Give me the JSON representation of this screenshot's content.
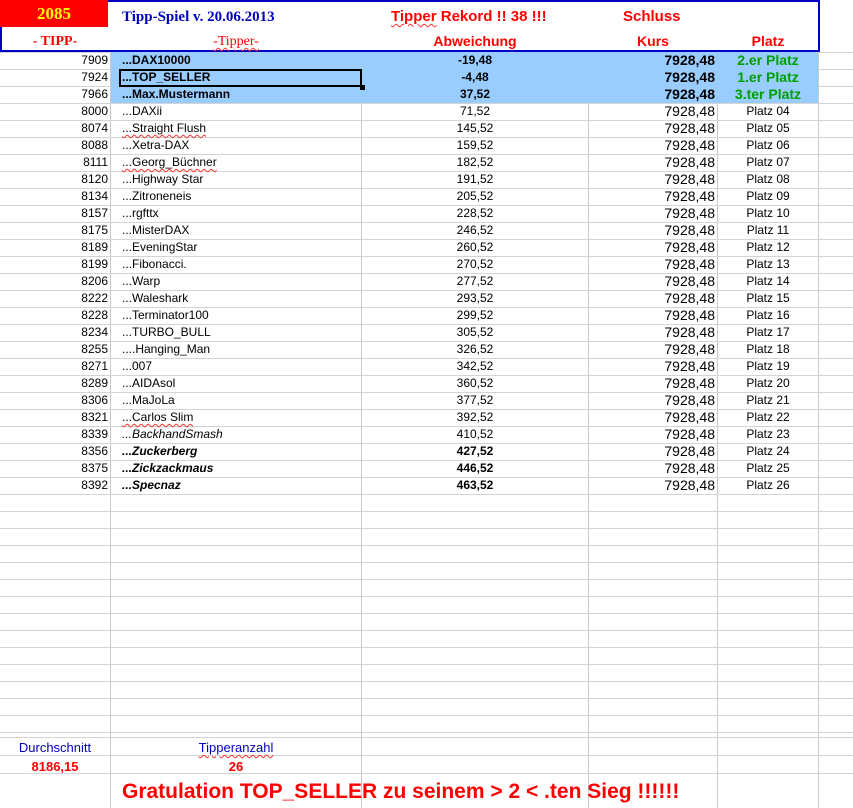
{
  "header": {
    "number": "2085",
    "title": "Tipp-Spiel v. 20.06.2013",
    "record_word": "Tipper",
    "record_rest": " Rekord !!  38  !!!",
    "schluss": "Schluss",
    "col_tipp": "- TIPP-",
    "col_tipper": "-Tipper-",
    "col_abweichung": "Abweichung",
    "col_kurs": "Kurs",
    "col_platz": "Platz"
  },
  "rows": [
    {
      "tipp": "7909",
      "name": "...DAX10000",
      "abw": "-19,48",
      "kurs": "7928,48",
      "platz": "2.er Platz"
    },
    {
      "tipp": "7924",
      "name": "...TOP_SELLER",
      "abw": "-4,48",
      "kurs": "7928,48",
      "platz": "1.er Platz"
    },
    {
      "tipp": "7966",
      "name": "...Max.Mustermann",
      "abw": "37,52",
      "kurs": "7928,48",
      "platz": "3.ter Platz"
    },
    {
      "tipp": "8000",
      "name": "...DAXii",
      "abw": "71,52",
      "kurs": "7928,48",
      "platz": "Platz 04"
    },
    {
      "tipp": "8074",
      "name": "...Straight Flush",
      "abw": "145,52",
      "kurs": "7928,48",
      "platz": "Platz 05"
    },
    {
      "tipp": "8088",
      "name": "...Xetra-DAX",
      "abw": "159,52",
      "kurs": "7928,48",
      "platz": "Platz 06"
    },
    {
      "tipp": "8111",
      "name": "...Georg_Büchner",
      "abw": "182,52",
      "kurs": "7928,48",
      "platz": "Platz 07"
    },
    {
      "tipp": "8120",
      "name": "...Highway Star",
      "abw": "191,52",
      "kurs": "7928,48",
      "platz": "Platz 08"
    },
    {
      "tipp": "8134",
      "name": "...Zitroneneis",
      "abw": "205,52",
      "kurs": "7928,48",
      "platz": "Platz 09"
    },
    {
      "tipp": "8157",
      "name": "...rgfttx",
      "abw": "228,52",
      "kurs": "7928,48",
      "platz": "Platz 10"
    },
    {
      "tipp": "8175",
      "name": "...MisterDAX",
      "abw": "246,52",
      "kurs": "7928,48",
      "platz": "Platz 11"
    },
    {
      "tipp": "8189",
      "name": "...EveningStar",
      "abw": "260,52",
      "kurs": "7928,48",
      "platz": "Platz 12"
    },
    {
      "tipp": "8199",
      "name": "...Fibonacci.",
      "abw": "270,52",
      "kurs": "7928,48",
      "platz": "Platz 13"
    },
    {
      "tipp": "8206",
      "name": "...Warp",
      "abw": "277,52",
      "kurs": "7928,48",
      "platz": "Platz 14"
    },
    {
      "tipp": "8222",
      "name": "...Waleshark",
      "abw": "293,52",
      "kurs": "7928,48",
      "platz": "Platz 15"
    },
    {
      "tipp": "8228",
      "name": "...Terminator100",
      "abw": "299,52",
      "kurs": "7928,48",
      "platz": "Platz 16"
    },
    {
      "tipp": "8234",
      "name": "...TURBO_BULL",
      "abw": "305,52",
      "kurs": "7928,48",
      "platz": "Platz 17"
    },
    {
      "tipp": "8255",
      "name": "....Hanging_Man",
      "abw": "326,52",
      "kurs": "7928,48",
      "platz": "Platz 18"
    },
    {
      "tipp": "8271",
      "name": "...007",
      "abw": "342,52",
      "kurs": "7928,48",
      "platz": "Platz 19"
    },
    {
      "tipp": "8289",
      "name": "...AIDAsol",
      "abw": "360,52",
      "kurs": "7928,48",
      "platz": "Platz 20"
    },
    {
      "tipp": "8306",
      "name": "...MaJoLa",
      "abw": "377,52",
      "kurs": "7928,48",
      "platz": "Platz 21"
    },
    {
      "tipp": "8321",
      "name": "...Carlos Slim",
      "abw": "392,52",
      "kurs": "7928,48",
      "platz": "Platz 22"
    },
    {
      "tipp": "8339",
      "name": "...BackhandSmash",
      "abw": "410,52",
      "kurs": "7928,48",
      "platz": "Platz 23"
    },
    {
      "tipp": "8356",
      "name": "...Zuckerberg",
      "abw": "427,52",
      "kurs": "7928,48",
      "platz": "Platz 24"
    },
    {
      "tipp": "8375",
      "name": "...Zickzackmaus",
      "abw": "446,52",
      "kurs": "7928,48",
      "platz": "Platz 25"
    },
    {
      "tipp": "8392",
      "name": "...Specnaz",
      "abw": "463,52",
      "kurs": "7928,48",
      "platz": "Platz 26"
    }
  ],
  "footer": {
    "durchschnitt_label": "Durchschnitt",
    "durchschnitt_value": "8186,15",
    "tipperanzahl_label": "Tipperanzahl",
    "tipperanzahl_value": "26",
    "gratulation": "Gratulation TOP_SELLER zu seinem > 2 < .ten Sieg !!!!!!"
  },
  "colors": {
    "header_border": "#0000c0",
    "number_bg": "#ff0000",
    "highlight_row": "#99ccff",
    "podium_green": "#00a000"
  }
}
